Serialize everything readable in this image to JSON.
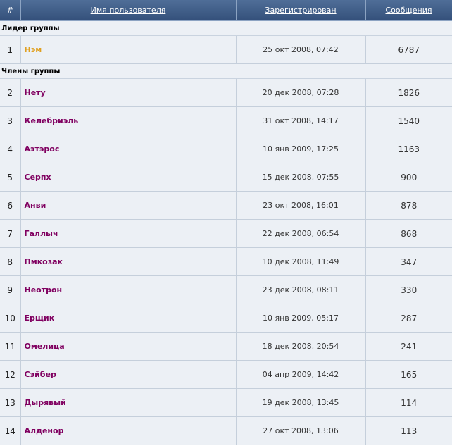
{
  "header": {
    "num": "#",
    "username": "Имя пользователя",
    "registered": "Зарегистрирован",
    "posts": "Сообщения"
  },
  "colors": {
    "header_bg": "#3e5c87",
    "row_bg": "#ecf0f5",
    "leader_name": "#e0a020",
    "member_name": "#800060"
  },
  "leaders": {
    "title": "Лидер группы",
    "rows": [
      {
        "num": "1",
        "name": "Нэм",
        "registered": "25 окт 2008, 07:42",
        "posts": "6787"
      }
    ]
  },
  "members": {
    "title": "Члены группы",
    "rows": [
      {
        "num": "2",
        "name": "Нету",
        "registered": "20 дек 2008, 07:28",
        "posts": "1826"
      },
      {
        "num": "3",
        "name": "Келебриэль",
        "registered": "31 окт 2008, 14:17",
        "posts": "1540"
      },
      {
        "num": "4",
        "name": "Аэтэрос",
        "registered": "10 янв 2009, 17:25",
        "posts": "1163"
      },
      {
        "num": "5",
        "name": "Серпх",
        "registered": "15 дек 2008, 07:55",
        "posts": "900"
      },
      {
        "num": "6",
        "name": "Анви",
        "registered": "23 окт 2008, 16:01",
        "posts": "878"
      },
      {
        "num": "7",
        "name": "Галлыч",
        "registered": "22 дек 2008, 06:54",
        "posts": "868"
      },
      {
        "num": "8",
        "name": "Пмкозак",
        "registered": "10 дек 2008, 11:49",
        "posts": "347"
      },
      {
        "num": "9",
        "name": "Неотрон",
        "registered": "23 дек 2008, 08:11",
        "posts": "330"
      },
      {
        "num": "10",
        "name": "Ерщик",
        "registered": "10 янв 2009, 05:17",
        "posts": "287"
      },
      {
        "num": "11",
        "name": "Омелица",
        "registered": "18 дек 2008, 20:54",
        "posts": "241"
      },
      {
        "num": "12",
        "name": "Сэйбер",
        "registered": "04 апр 2009, 14:42",
        "posts": "165"
      },
      {
        "num": "13",
        "name": "Дырявый",
        "registered": "19 дек 2008, 13:45",
        "posts": "114"
      },
      {
        "num": "14",
        "name": "Алденор",
        "registered": "27 окт 2008, 13:06",
        "posts": "113"
      }
    ]
  }
}
